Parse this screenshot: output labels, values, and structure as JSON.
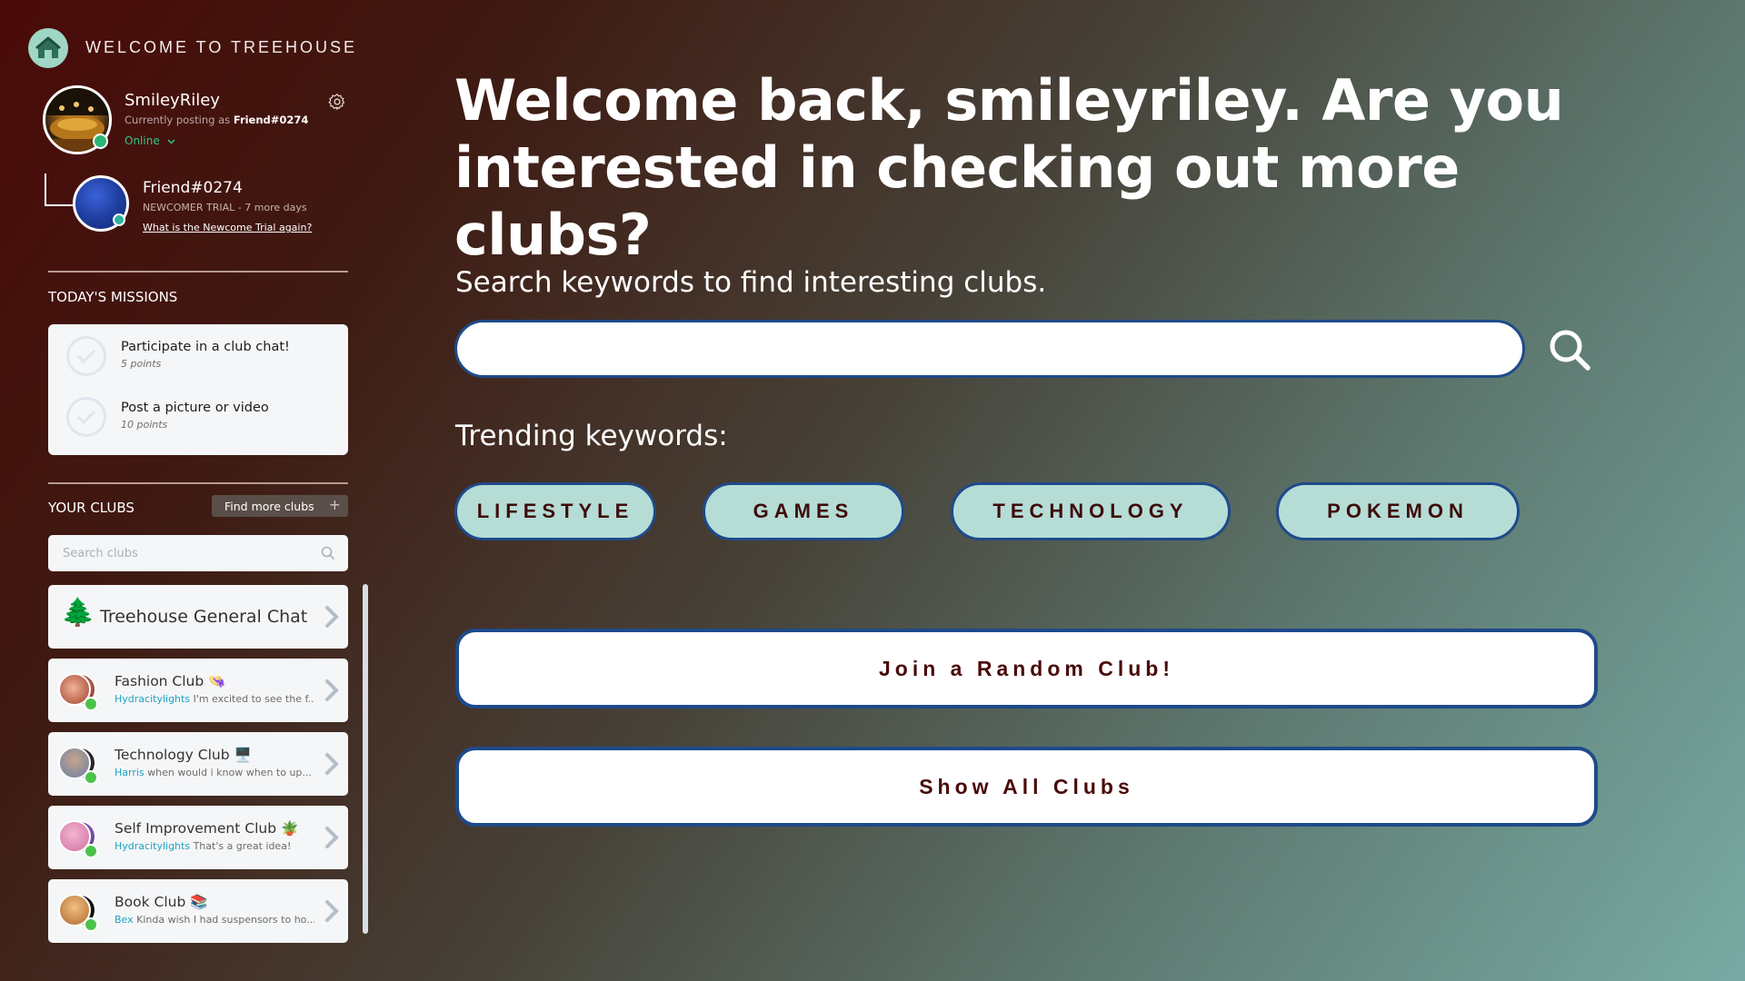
{
  "brand": {
    "title": "WELCOME TO TREEHOUSE",
    "logo_icon": "house-icon"
  },
  "profile": {
    "username": "SmileyRiley",
    "posting_prefix": "Currently posting as",
    "posting_as": "Friend#0274",
    "status": "Online",
    "status_color": "#36c38a"
  },
  "friend": {
    "name": "Friend#0274",
    "trial": "NEWCOMER TRIAL - 7 more days",
    "trial_link": "What is the Newcome Trial again?"
  },
  "missions": {
    "title": "TODAY'S MISSIONS",
    "items": [
      {
        "title": "Participate in a club chat!",
        "points": "5 points"
      },
      {
        "title": "Post a picture or video",
        "points": "10 points"
      }
    ]
  },
  "clubs": {
    "title": "YOUR CLUBS",
    "find_more": "Find more clubs",
    "find_more_icon": "+",
    "search_placeholder": "Search clubs",
    "general": {
      "emoji": "🌲",
      "name": "Treehouse General Chat"
    },
    "items": [
      {
        "name": "Fashion Club",
        "emoji": "👒",
        "user": "Hydracitylights",
        "preview": "I'm excited to see the f..."
      },
      {
        "name": "Technology Club",
        "emoji": "🖥️",
        "user": "Harris",
        "preview": "when would i know when to up..."
      },
      {
        "name": "Self Improvement Club",
        "emoji": "🪴",
        "user": "Hydracitylights",
        "preview": "That's a great idea!"
      },
      {
        "name": "Book Club",
        "emoji": "📚",
        "user": "Bex",
        "preview": "Kinda wish I had suspensors to ho..."
      }
    ]
  },
  "main": {
    "headline": "Welcome back, smileyriley. Are you interested in checking out more clubs?",
    "search_label": "Search keywords to find interesting clubs.",
    "search_value": "",
    "trending_label": "Trending keywords:",
    "keywords": [
      "LIFESTYLE",
      "GAMES",
      "TECHNOLOGY",
      "POKEMON"
    ],
    "random_club": "Join a Random Club!",
    "show_all": "Show All Clubs"
  },
  "colors": {
    "accent_border": "#1e4a8a",
    "pill_fill": "#b5ddd6",
    "button_text": "#4a0a0a",
    "preview_user": "#1fa3c4"
  }
}
